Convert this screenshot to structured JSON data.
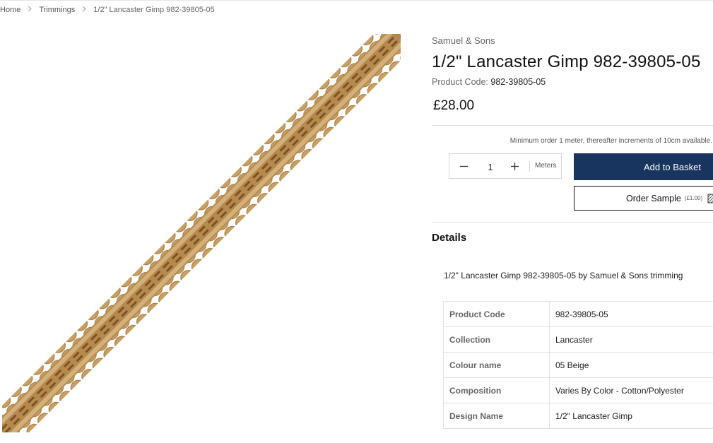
{
  "breadcrumb": {
    "items": [
      "Home",
      "Trimmings"
    ],
    "current": "1/2\" Lancaster Gimp 982-39805-05"
  },
  "product": {
    "brand": "Samuel & Sons",
    "title": "1/2\" Lancaster Gimp 982-39805-05",
    "code_label": "Product Code:",
    "code_value": "982-39805-05",
    "price": "£28.00",
    "image_alt": "beige gimp trimming braid"
  },
  "order": {
    "min_order_note": "Minimum order 1 meter, thereafter increments of 10cm available.",
    "quantity": "1",
    "unit": "Meters",
    "add_to_basket": "Add to Basket",
    "order_sample": "Order Sample",
    "sample_price": "(£1.00)"
  },
  "details": {
    "heading": "Details",
    "description": "1/2\" Lancaster Gimp 982-39805-05 by Samuel & Sons trimming",
    "specs": [
      {
        "label": "Product Code",
        "value": "982-39805-05"
      },
      {
        "label": "Collection",
        "value": "Lancaster"
      },
      {
        "label": "Colour name",
        "value": "05 Beige"
      },
      {
        "label": "Composition",
        "value": "Varies By Color - Cotton/Polyester"
      },
      {
        "label": "Design Name",
        "value": "1/2\" Lancaster Gimp"
      }
    ]
  },
  "colors": {
    "primary_button": "#17355f",
    "trim_gold": "#b58a4e",
    "trim_brown": "#8a5a2b"
  },
  "icons": [
    "chevron-right-icon",
    "minus-icon",
    "plus-icon",
    "sample-tag-icon"
  ]
}
